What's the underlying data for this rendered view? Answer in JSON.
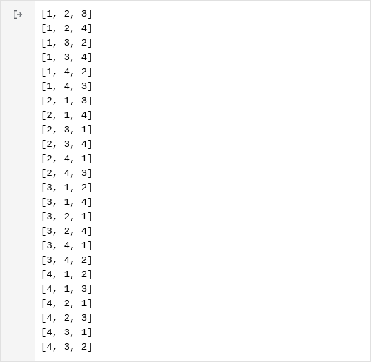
{
  "output": {
    "lines": [
      "[1, 2, 3]",
      "[1, 2, 4]",
      "[1, 3, 2]",
      "[1, 3, 4]",
      "[1, 4, 2]",
      "[1, 4, 3]",
      "[2, 1, 3]",
      "[2, 1, 4]",
      "[2, 3, 1]",
      "[2, 3, 4]",
      "[2, 4, 1]",
      "[2, 4, 3]",
      "[3, 1, 2]",
      "[3, 1, 4]",
      "[3, 2, 1]",
      "[3, 2, 4]",
      "[3, 4, 1]",
      "[3, 4, 2]",
      "[4, 1, 2]",
      "[4, 1, 3]",
      "[4, 2, 1]",
      "[4, 2, 3]",
      "[4, 3, 1]",
      "[4, 3, 2]"
    ]
  },
  "icons": {
    "output_icon": "output-bracket-arrow-icon"
  }
}
